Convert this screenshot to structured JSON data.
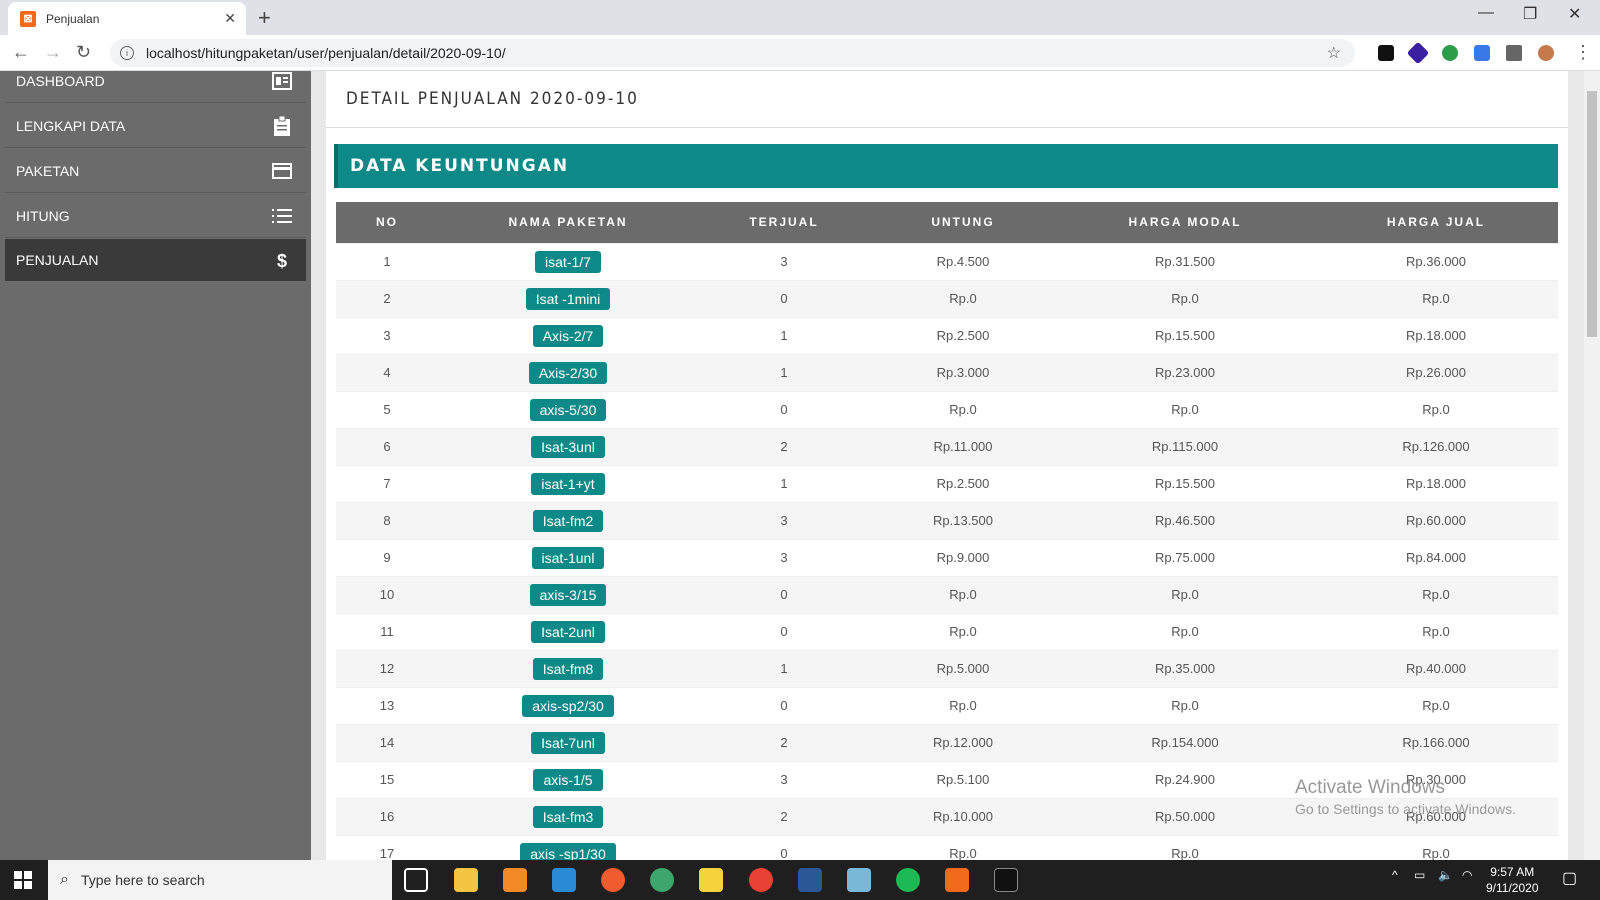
{
  "browser": {
    "tab_title": "Penjualan",
    "url": "localhost/hitungpaketan/user/penjualan/detail/2020-09-10/"
  },
  "sidebar": {
    "items": [
      {
        "label": "DASHBOARD",
        "icon": "dashboard-icon"
      },
      {
        "label": "LENGKAPI DATA",
        "icon": "clipboard-icon"
      },
      {
        "label": "PAKETAN",
        "icon": "card-icon"
      },
      {
        "label": "HITUNG",
        "icon": "list-icon"
      },
      {
        "label": "PENJUALAN",
        "icon": "dollar-icon",
        "active": true
      }
    ]
  },
  "main": {
    "page_title": "DETAIL PENJUALAN 2020-09-10",
    "card_title": "DATA KEUNTUNGAN",
    "columns": [
      "NO",
      "NAMA PAKETAN",
      "TERJUAL",
      "UNTUNG",
      "HARGA MODAL",
      "HARGA JUAL"
    ],
    "rows": [
      {
        "no": "1",
        "nama": "isat-1/7",
        "terjual": "3",
        "untung": "Rp.4.500",
        "modal": "Rp.31.500",
        "jual": "Rp.36.000"
      },
      {
        "no": "2",
        "nama": "Isat -1mini",
        "terjual": "0",
        "untung": "Rp.0",
        "modal": "Rp.0",
        "jual": "Rp.0"
      },
      {
        "no": "3",
        "nama": "Axis-2/7",
        "terjual": "1",
        "untung": "Rp.2.500",
        "modal": "Rp.15.500",
        "jual": "Rp.18.000"
      },
      {
        "no": "4",
        "nama": "Axis-2/30",
        "terjual": "1",
        "untung": "Rp.3.000",
        "modal": "Rp.23.000",
        "jual": "Rp.26.000"
      },
      {
        "no": "5",
        "nama": "axis-5/30",
        "terjual": "0",
        "untung": "Rp.0",
        "modal": "Rp.0",
        "jual": "Rp.0"
      },
      {
        "no": "6",
        "nama": "Isat-3unl",
        "terjual": "2",
        "untung": "Rp.11.000",
        "modal": "Rp.115.000",
        "jual": "Rp.126.000"
      },
      {
        "no": "7",
        "nama": "isat-1+yt",
        "terjual": "1",
        "untung": "Rp.2.500",
        "modal": "Rp.15.500",
        "jual": "Rp.18.000"
      },
      {
        "no": "8",
        "nama": "Isat-fm2",
        "terjual": "3",
        "untung": "Rp.13.500",
        "modal": "Rp.46.500",
        "jual": "Rp.60.000"
      },
      {
        "no": "9",
        "nama": "isat-1unl",
        "terjual": "3",
        "untung": "Rp.9.000",
        "modal": "Rp.75.000",
        "jual": "Rp.84.000"
      },
      {
        "no": "10",
        "nama": "axis-3/15",
        "terjual": "0",
        "untung": "Rp.0",
        "modal": "Rp.0",
        "jual": "Rp.0"
      },
      {
        "no": "11",
        "nama": "Isat-2unl",
        "terjual": "0",
        "untung": "Rp.0",
        "modal": "Rp.0",
        "jual": "Rp.0"
      },
      {
        "no": "12",
        "nama": "Isat-fm8",
        "terjual": "1",
        "untung": "Rp.5.000",
        "modal": "Rp.35.000",
        "jual": "Rp.40.000"
      },
      {
        "no": "13",
        "nama": "axis-sp2/30",
        "terjual": "0",
        "untung": "Rp.0",
        "modal": "Rp.0",
        "jual": "Rp.0"
      },
      {
        "no": "14",
        "nama": "Isat-7unl",
        "terjual": "2",
        "untung": "Rp.12.000",
        "modal": "Rp.154.000",
        "jual": "Rp.166.000"
      },
      {
        "no": "15",
        "nama": "axis-1/5",
        "terjual": "3",
        "untung": "Rp.5.100",
        "modal": "Rp.24.900",
        "jual": "Rp.30.000"
      },
      {
        "no": "16",
        "nama": "Isat-fm3",
        "terjual": "2",
        "untung": "Rp.10.000",
        "modal": "Rp.50.000",
        "jual": "Rp.60.000"
      },
      {
        "no": "17",
        "nama": "axis -sp1/30",
        "terjual": "0",
        "untung": "Rp.0",
        "modal": "Rp.0",
        "jual": "Rp.0"
      }
    ]
  },
  "watermark": {
    "line1": "Activate Windows",
    "line2": "Go to Settings to activate Windows."
  },
  "taskbar": {
    "search_placeholder": "Type here to search",
    "time": "9:57 AM",
    "date": "9/11/2020"
  },
  "colors": {
    "accent": "#0d8a87",
    "sidebar": "#6b6b6b",
    "sidebar_active": "#3a3a3a"
  }
}
